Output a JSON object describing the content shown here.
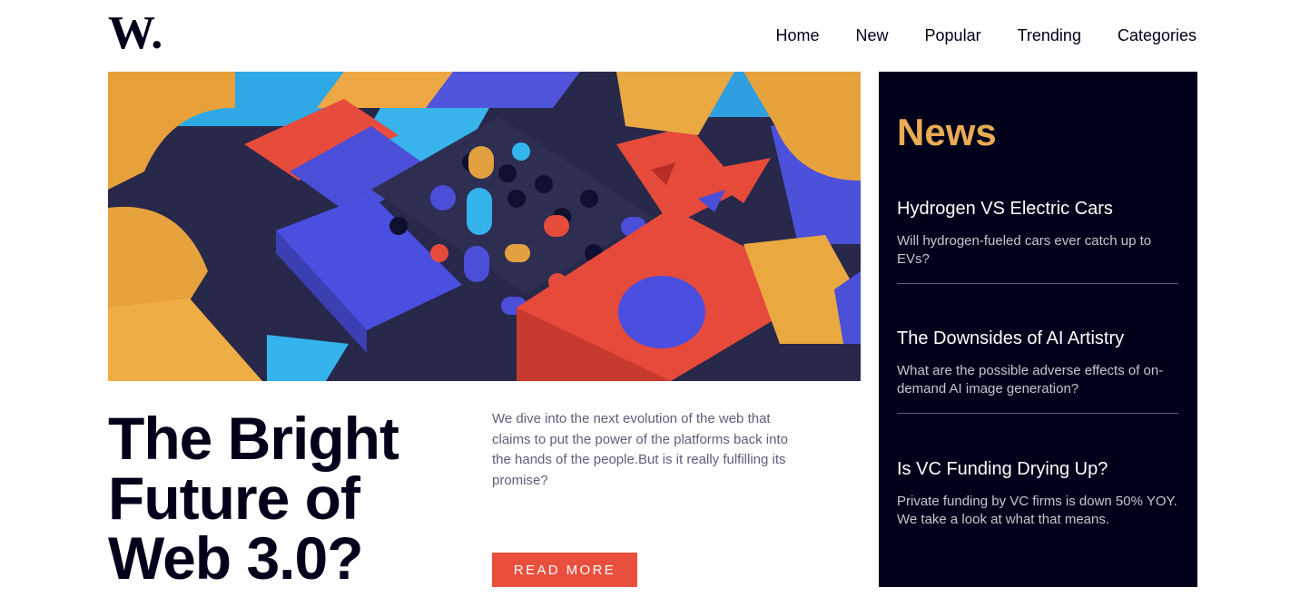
{
  "logo": {
    "text": "W."
  },
  "nav": {
    "items": [
      "Home",
      "New",
      "Popular",
      "Trending",
      "Categories"
    ]
  },
  "hero": {
    "headline_lines": [
      "The Bright",
      "Future of",
      "Web 3.0?"
    ],
    "description": "We dive into the next evolution of the web that claims to put the power of the platforms back into the hands of the people.But is it really fulfilling its promise?",
    "cta_label": "READ MORE"
  },
  "news": {
    "title": "News",
    "items": [
      {
        "title": "Hydrogen VS Electric Cars",
        "summary": "Will hydrogen-fueled cars ever catch up to EVs?"
      },
      {
        "title": "The Downsides of AI Artistry",
        "summary": "What are the possible adverse effects of on-demand AI image generation?"
      },
      {
        "title": "Is VC Funding Drying Up?",
        "summary": "Private funding by VC firms is down 50% YOY. We take a look at what that means."
      }
    ]
  },
  "colors": {
    "dark_navy": "#00001a",
    "soft_orange": "#e9ab53",
    "soft_red": "#e84f3d",
    "grayish_blue": "#5d5f79"
  }
}
